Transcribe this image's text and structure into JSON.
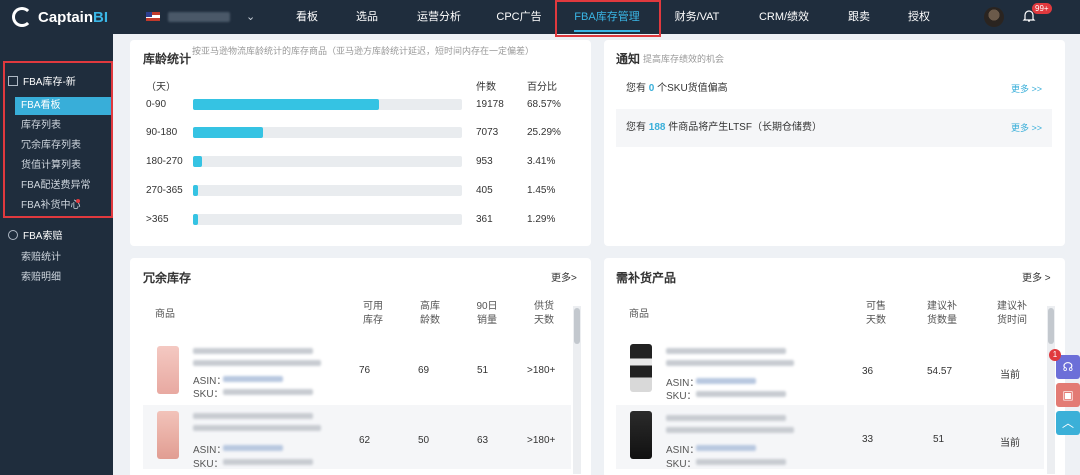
{
  "topbar": {
    "logo": "Captain",
    "logo_accent": "BI",
    "nav": [
      "看板",
      "选品",
      "运营分析",
      "CPC广告",
      "FBA库存管理",
      "财务/VAT",
      "CRM/绩效",
      "跟卖",
      "授权"
    ],
    "notification_badge": "99+"
  },
  "sidebar": {
    "group1": "FBA库存-新",
    "items": [
      "FBA看板",
      "库存列表",
      "冗余库存列表",
      "货值计算列表",
      "FBA配送费异常",
      "FBA补货中心"
    ],
    "group2": "FBA索赔",
    "items2": [
      "索赔统计",
      "索赔明细"
    ]
  },
  "age": {
    "title": "库龄统计",
    "subtitle": "按亚马逊物流库龄统计的库存商品（亚马逊方库龄统计延迟，短时间内存在一定偏差）",
    "col_days": "（天）",
    "col_count": "件数",
    "col_pct": "百分比",
    "rows": [
      {
        "range": "0-90",
        "count": "19178",
        "pct": "68.57%",
        "fill": 0.69
      },
      {
        "range": "90-180",
        "count": "7073",
        "pct": "25.29%",
        "fill": 0.26
      },
      {
        "range": "180-270",
        "count": "953",
        "pct": "3.41%",
        "fill": 0.035
      },
      {
        "range": "270-365",
        "count": "405",
        "pct": "1.45%",
        "fill": 0.016
      },
      {
        "range": ">365",
        "count": "361",
        "pct": "1.29%",
        "fill": 0.013
      }
    ]
  },
  "notice": {
    "title": "通知",
    "subtitle": "提高库存绩效的机会",
    "row1_pre": "您有",
    "row1_num": "0",
    "row1_post": "个SKU货值偏高",
    "row2_pre": "您有",
    "row2_num": "188",
    "row2_post": "件商品将产生LTSF（长期仓储费）",
    "more": "更多 >>"
  },
  "excess": {
    "title": "冗余库存",
    "more": "更多>",
    "headers": [
      "商品",
      "可用\n库存",
      "高库\n龄数",
      "90日\n销量",
      "供货\n天数"
    ],
    "rows": [
      {
        "asin": "ASIN：",
        "sku": "SKU：",
        "stock": "76",
        "aged": "69",
        "sales": "51",
        "days": ">180+"
      },
      {
        "asin": "ASIN：",
        "sku": "SKU：",
        "stock": "62",
        "aged": "50",
        "sales": "63",
        "days": ">180+"
      }
    ]
  },
  "replenish": {
    "title": "需补货产品",
    "more": "更多 >",
    "headers": [
      "商品",
      "可售\n天数",
      "建议补\n货数量",
      "建议补\n货时间"
    ],
    "rows": [
      {
        "asin": "ASIN：",
        "sku": "SKU：",
        "days": "36",
        "qty": "54.57",
        "time": "当前"
      },
      {
        "asin": "ASIN：",
        "sku": "SKU：",
        "days": "33",
        "qty": "51",
        "time": "当前"
      }
    ]
  },
  "float": {
    "badge": "1"
  },
  "colors": {
    "accent": "#38aed9",
    "bar": "#35c3e3",
    "highlight": "#e0393e",
    "nav_bg": "#1f2d3d"
  }
}
